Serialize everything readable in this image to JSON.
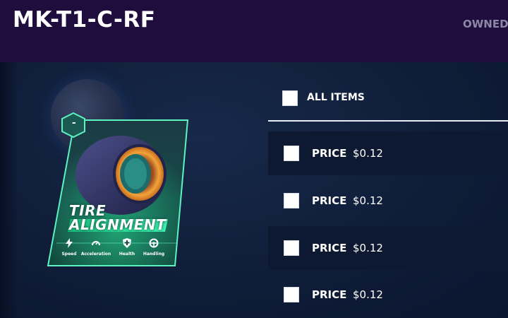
{
  "header": {
    "title": "MK-T1-C-RF",
    "owned_label": "OWNED"
  },
  "card": {
    "badge": "-",
    "name_line1": "TIRE",
    "name_line2": "ALIGNMENT",
    "stats": [
      {
        "label": "Speed",
        "icon": "lightning-icon"
      },
      {
        "label": "Acceleration",
        "icon": "speedometer-icon"
      },
      {
        "label": "Health",
        "icon": "shield-plus-icon"
      },
      {
        "label": "Handling",
        "icon": "steering-wheel-icon"
      }
    ],
    "accent_color": "#3ee8a4"
  },
  "list": {
    "all_items_label": "ALL ITEMS",
    "rows": [
      {
        "price_label": "PRICE",
        "price_value": "$0.12"
      },
      {
        "price_label": "PRICE",
        "price_value": "$0.12"
      },
      {
        "price_label": "PRICE",
        "price_value": "$0.12"
      },
      {
        "price_label": "PRICE",
        "price_value": "$0.12"
      }
    ]
  }
}
